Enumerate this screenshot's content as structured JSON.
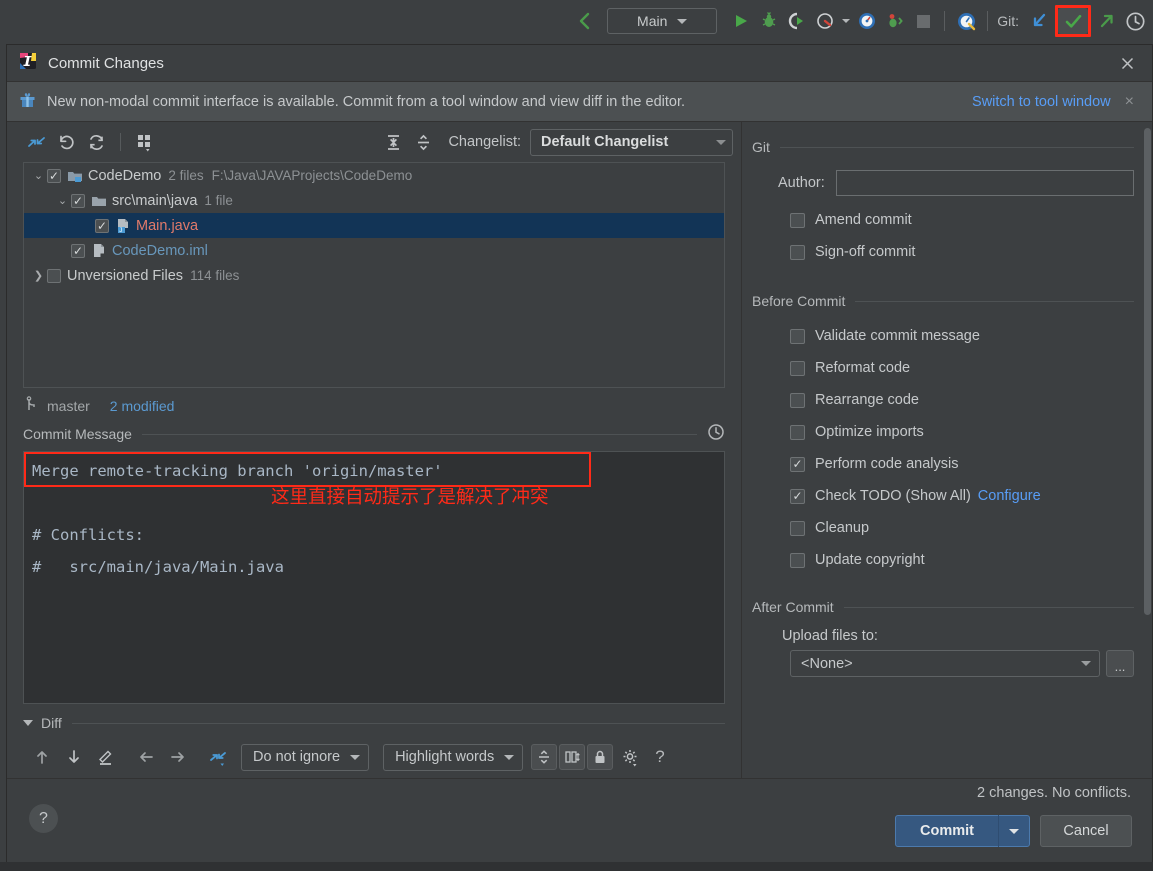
{
  "ide_toolbar": {
    "run_config": "Main",
    "git_label": "Git:",
    "icons": {
      "back_arrow": "back-arrow-icon",
      "run": "run-icon",
      "debug": "debug-icon",
      "run_coverage": "run-with-coverage-icon",
      "profiler": "profiler-icon",
      "profiler_caret": "chevron-down-icon",
      "attach": "attach-debugger-icon",
      "stop": "stop-icon",
      "search_everywhere": "search-everywhere-icon",
      "update_project": "update-project-icon",
      "commit": "commit-checkmark-icon",
      "push": "push-arrow-icon",
      "history": "history-clock-icon"
    }
  },
  "dialog": {
    "title": "Commit Changes",
    "close_icon": "close-icon",
    "app_icon": "intellij-idea-icon"
  },
  "notice": {
    "icon": "gift-icon",
    "text": "New non-modal commit interface is available. Commit from a tool window and view diff in the editor.",
    "link": "Switch to tool window",
    "close": "×"
  },
  "changes_toolbar": {
    "icons": {
      "show_diff": "show-diff-icon",
      "revert": "revert-icon",
      "refresh": "refresh-icon",
      "group_by": "group-by-icon",
      "expand_all": "expand-all-icon",
      "collapse_all": "collapse-all-icon"
    },
    "changelist_label": "Changelist:",
    "changelist_value": "Default Changelist"
  },
  "tree": [
    {
      "label": "CodeDemo",
      "count": "2 files",
      "path": "F:\\Java\\JAVAProjects\\CodeDemo",
      "arrow": "expanded",
      "checked": true,
      "indent": 0,
      "icon": "module-folder-icon",
      "selected": false,
      "color": "default"
    },
    {
      "label": "src\\main\\java",
      "count": "1 file",
      "path": "",
      "arrow": "expanded",
      "checked": true,
      "indent": 1,
      "icon": "folder-icon",
      "selected": false,
      "color": "default"
    },
    {
      "label": "Main.java",
      "count": "",
      "path": "",
      "arrow": "none",
      "checked": true,
      "indent": 2,
      "icon": "java-file-icon",
      "selected": true,
      "color": "merged"
    },
    {
      "label": "CodeDemo.iml",
      "count": "",
      "path": "",
      "arrow": "none",
      "checked": true,
      "indent": 1,
      "icon": "iml-file-icon",
      "selected": false,
      "color": "modified"
    },
    {
      "label": "Unversioned Files",
      "count": "114 files",
      "path": "",
      "arrow": "collapsed",
      "checked": false,
      "indent": 0,
      "icon": "none",
      "selected": false,
      "color": "default"
    }
  ],
  "branch_bar": {
    "icon": "branch-icon",
    "branch": "master",
    "modified": "2 modified"
  },
  "commit_message": {
    "section_label": "Commit Message",
    "history_icon": "history-clock-icon",
    "line1": "Merge remote-tracking branch 'origin/master'",
    "line2": "",
    "line3": "# Conflicts:",
    "line4": "#   src/main/java/Main.java",
    "annotation": "这里直接自动提示了是解决了冲突"
  },
  "diff": {
    "section_label": "Diff",
    "icons": {
      "prev_diff": "arrow-up-icon",
      "next_diff": "arrow-down-icon",
      "edit": "edit-pencil-icon",
      "accept_left": "arrow-left-icon",
      "accept_right": "arrow-right-icon",
      "compare": "compare-icon",
      "collapse_unchanged": "collapse-unchanged-icon",
      "side_by_side": "side-by-side-icon",
      "read_only": "lock-icon",
      "settings": "gear-icon",
      "help": "?"
    },
    "ignore_combo": "Do not ignore",
    "highlight_combo": "Highlight words"
  },
  "right_panel": {
    "git_group": "Git",
    "author_label": "Author:",
    "author_value": "",
    "git_options": [
      {
        "label": "Amend commit",
        "checked": false
      },
      {
        "label": "Sign-off commit",
        "checked": false
      }
    ],
    "before_commit_group": "Before Commit",
    "before_commit_options": [
      {
        "label": "Validate commit message",
        "checked": false,
        "link": ""
      },
      {
        "label": "Reformat code",
        "checked": false,
        "link": ""
      },
      {
        "label": "Rearrange code",
        "checked": false,
        "link": ""
      },
      {
        "label": "Optimize imports",
        "checked": false,
        "link": ""
      },
      {
        "label": "Perform code analysis",
        "checked": true,
        "link": ""
      },
      {
        "label": "Check TODO (Show All)",
        "checked": true,
        "link": "Configure"
      },
      {
        "label": "Cleanup",
        "checked": false,
        "link": ""
      },
      {
        "label": "Update copyright",
        "checked": false,
        "link": ""
      }
    ],
    "after_commit_group": "After Commit",
    "upload_label": "Upload files to:",
    "upload_value": "<None>",
    "upload_browse": "..."
  },
  "footer": {
    "help": "?",
    "status": "2 changes. No conflicts.",
    "commit_button": "Commit",
    "commit_caret_icon": "chevron-down-icon",
    "cancel_button": "Cancel"
  },
  "colors": {
    "accent_blue": "#589df6",
    "commit_button": "#365880",
    "highlight_red": "#ff2a18",
    "selection": "#123456",
    "merged_file": "#e07a6a",
    "modified_file": "#6897bb"
  }
}
